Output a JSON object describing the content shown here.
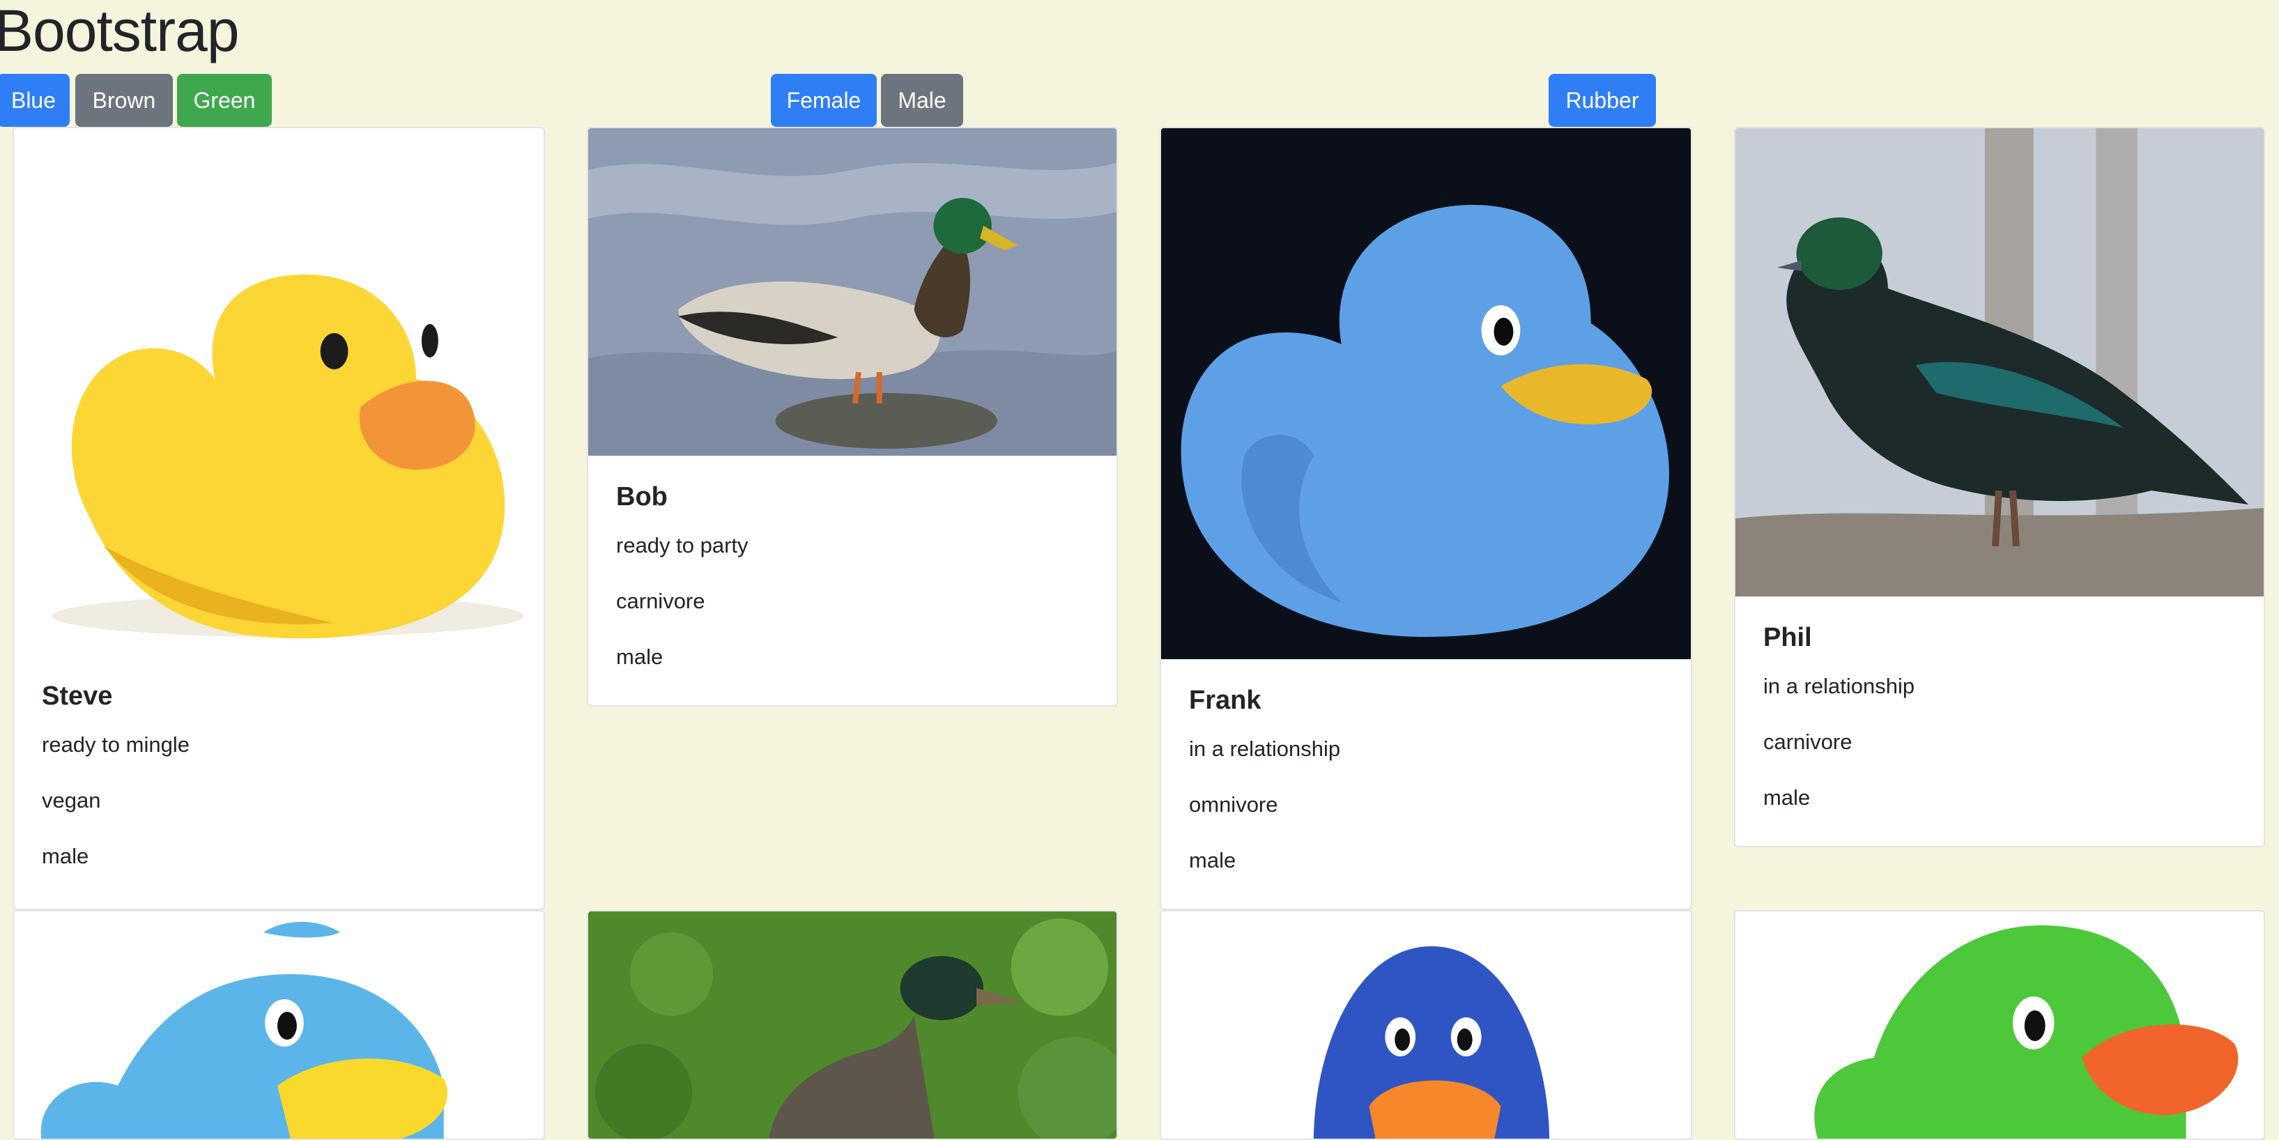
{
  "title": "Bootstrap",
  "filters": {
    "color": [
      "Blue",
      "Brown",
      "Green"
    ],
    "gender": [
      "Female",
      "Male"
    ],
    "material": [
      "Rubber"
    ]
  },
  "cards": [
    {
      "name": "Steve",
      "status": "ready to mingle",
      "diet": "vegan",
      "gender": "male"
    },
    {
      "name": "Bob",
      "status": "ready to party",
      "diet": "carnivore",
      "gender": "male"
    },
    {
      "name": "Frank",
      "status": "in a relationship",
      "diet": "omnivore",
      "gender": "male"
    },
    {
      "name": "Phil",
      "status": "in a relationship",
      "diet": "carnivore",
      "gender": "male"
    }
  ],
  "colors": {
    "background": "#f5f4dc",
    "primary": "#2f7ef6",
    "secondary": "#6c757d",
    "success": "#3fa84f"
  }
}
